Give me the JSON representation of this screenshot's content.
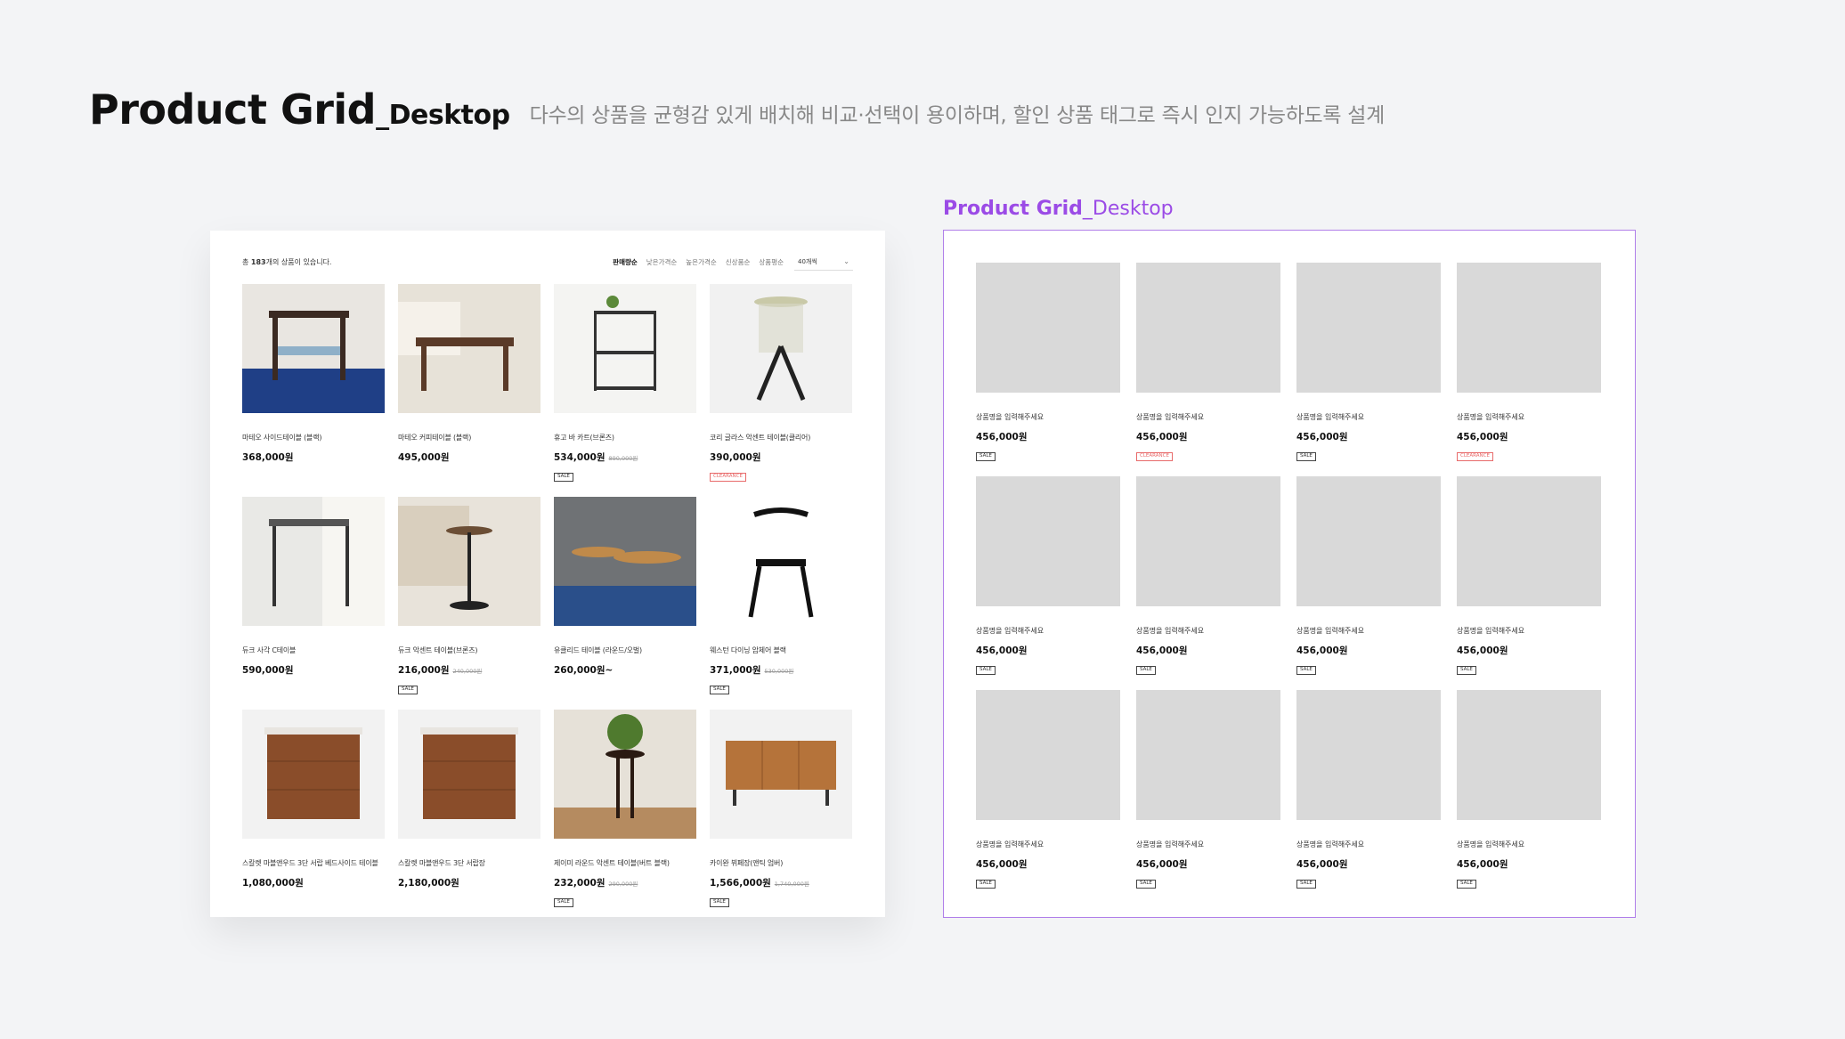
{
  "header": {
    "title": "Product Grid",
    "title_sub": "_Desktop",
    "description": "다수의 상품을 균형감 있게 배치해 비교·선택이 용이하며, 할인 상품 태그로 즉시 인지 가능하도록 설계"
  },
  "mockup": {
    "count_prefix": "총 ",
    "count": "183",
    "count_suffix": "개의 상품이 있습니다.",
    "sort_options": [
      "판매량순",
      "낮은가격순",
      "높은가격순",
      "신상품순",
      "상품평순"
    ],
    "per_page": "40개씩",
    "products": [
      {
        "name": "마테오 사이드테이블 (블랙)",
        "price": "368,000원",
        "orig": "",
        "tag": ""
      },
      {
        "name": "마테오 커피테이블 (블랙)",
        "price": "495,000원",
        "orig": "",
        "tag": ""
      },
      {
        "name": "휴고 바 카트(브론즈)",
        "price": "534,000원",
        "orig": "890,000원",
        "tag": "SALE"
      },
      {
        "name": "코리 글라스 악센트 테이블(클리어)",
        "price": "390,000원",
        "orig": "",
        "tag": "CLEARANCE"
      },
      {
        "name": "듀크 사각 C테이블",
        "price": "590,000원",
        "orig": "",
        "tag": ""
      },
      {
        "name": "듀크 악센트 테이블(브론즈)",
        "price": "216,000원",
        "orig": "240,000원",
        "tag": "SALE"
      },
      {
        "name": "유클리드 테이블 (라운드/오벌)",
        "price": "260,000원~",
        "orig": "",
        "tag": ""
      },
      {
        "name": "웨스턴 다이닝 암체어 블랙",
        "price": "371,000원",
        "orig": "530,000원",
        "tag": "SALE"
      },
      {
        "name": "스칼렛 마블앤우드 3단 서랍 베드사이드 테이블",
        "price": "1,080,000원",
        "orig": "",
        "tag": ""
      },
      {
        "name": "스칼렛 마블앤우드 3단 서랍장",
        "price": "2,180,000원",
        "orig": "",
        "tag": ""
      },
      {
        "name": "제이미 라운드 악센트 테이블(버트 블랙)",
        "price": "232,000원",
        "orig": "290,000원",
        "tag": "SALE"
      },
      {
        "name": "카이완 뷔페장(앤틱 엄버)",
        "price": "1,566,000원",
        "orig": "1,740,000원",
        "tag": "SALE"
      }
    ]
  },
  "wireframe": {
    "label": "Product Grid",
    "label_sub": "_Desktop",
    "items": [
      {
        "name": "상품명을 입력해주세요",
        "price": "456,000원",
        "tag": "SALE"
      },
      {
        "name": "상품명을 입력해주세요",
        "price": "456,000원",
        "tag": "CLEARANCE"
      },
      {
        "name": "상품명을 입력해주세요",
        "price": "456,000원",
        "tag": "SALE"
      },
      {
        "name": "상품명을 입력해주세요",
        "price": "456,000원",
        "tag": "CLEARANCE"
      },
      {
        "name": "상품명을 입력해주세요",
        "price": "456,000원",
        "tag": "SALE"
      },
      {
        "name": "상품명을 입력해주세요",
        "price": "456,000원",
        "tag": "SALE"
      },
      {
        "name": "상품명을 입력해주세요",
        "price": "456,000원",
        "tag": "SALE"
      },
      {
        "name": "상품명을 입력해주세요",
        "price": "456,000원",
        "tag": "SALE"
      },
      {
        "name": "상품명을 입력해주세요",
        "price": "456,000원",
        "tag": "SALE"
      },
      {
        "name": "상품명을 입력해주세요",
        "price": "456,000원",
        "tag": "SALE"
      },
      {
        "name": "상품명을 입력해주세요",
        "price": "456,000원",
        "tag": "SALE"
      },
      {
        "name": "상품명을 입력해주세요",
        "price": "456,000원",
        "tag": "SALE"
      }
    ]
  },
  "colors": {
    "background": "#f3f4f6",
    "accent_purple": "#9b4be6",
    "clearance_red": "#e86a6a",
    "placeholder_gray": "#d9d9d9"
  }
}
